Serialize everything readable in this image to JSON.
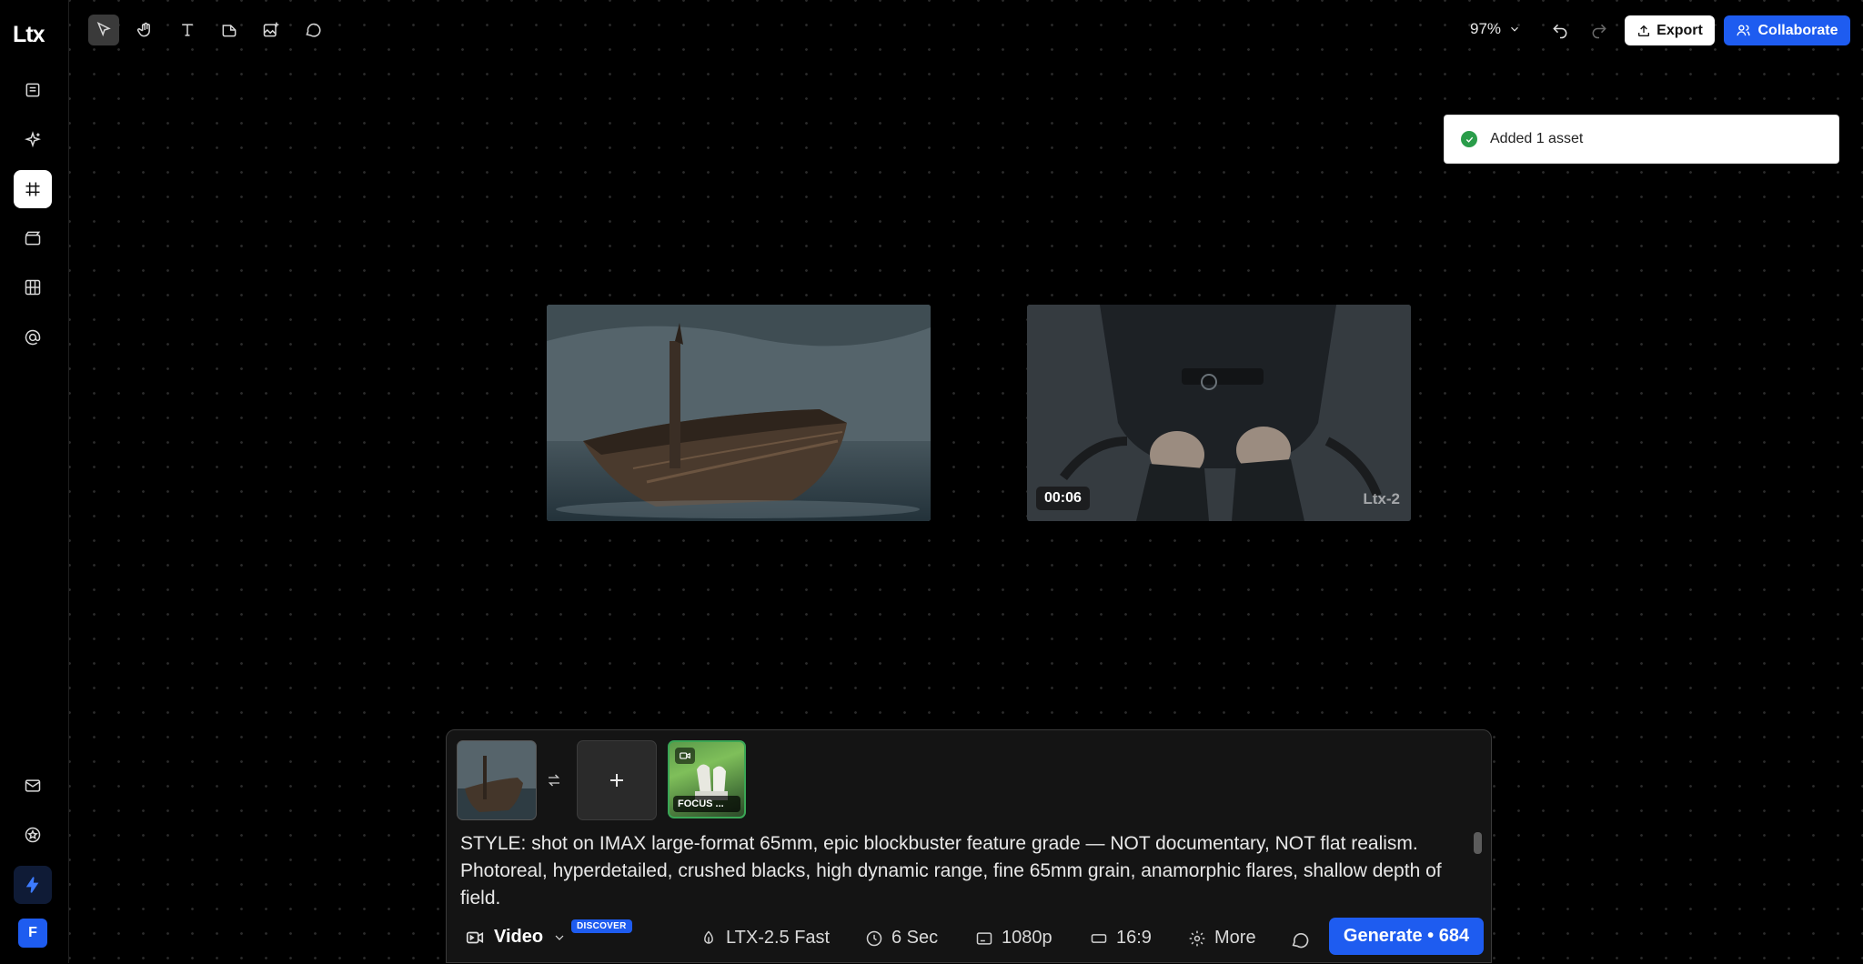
{
  "app": {
    "logo": "Ltx"
  },
  "sidebar": {
    "items": [
      {
        "name": "document"
      },
      {
        "name": "sparkles"
      },
      {
        "name": "frame"
      },
      {
        "name": "clapperboard"
      },
      {
        "name": "film-grid"
      },
      {
        "name": "at"
      }
    ],
    "bottom": [
      {
        "name": "mail"
      },
      {
        "name": "badge"
      },
      {
        "name": "bolt"
      }
    ],
    "avatar_initial": "F",
    "accent": "#1e5cf0"
  },
  "toolbar": {
    "tools": [
      "select",
      "hand",
      "text",
      "frame",
      "add-image",
      "comment"
    ],
    "zoom": "97%",
    "export_label": "Export",
    "collaborate_label": "Collaborate"
  },
  "toast": {
    "message": "Added 1 asset",
    "status_color": "#2a9d4a"
  },
  "canvas": {
    "cards": [
      {
        "name": "boat-clip"
      },
      {
        "name": "figure-clip",
        "duration": "00:06",
        "watermark": "Ltx-2"
      }
    ]
  },
  "composer": {
    "focus_label": "FOCUS ...",
    "prompt": "STYLE: shot on IMAX large-format 65mm, epic blockbuster feature grade — NOT documentary, NOT flat realism. Photoreal, hyperdetailed, crushed blacks, high dynamic range, fine 65mm grain, anamorphic flares, shallow depth of field.",
    "mode": "Video",
    "discover_badge": "DISCOVER",
    "model": "LTX-2.5 Fast",
    "duration": "6 Sec",
    "resolution": "1080p",
    "aspect": "16:9",
    "more": "More",
    "generate": "Generate • 684"
  }
}
